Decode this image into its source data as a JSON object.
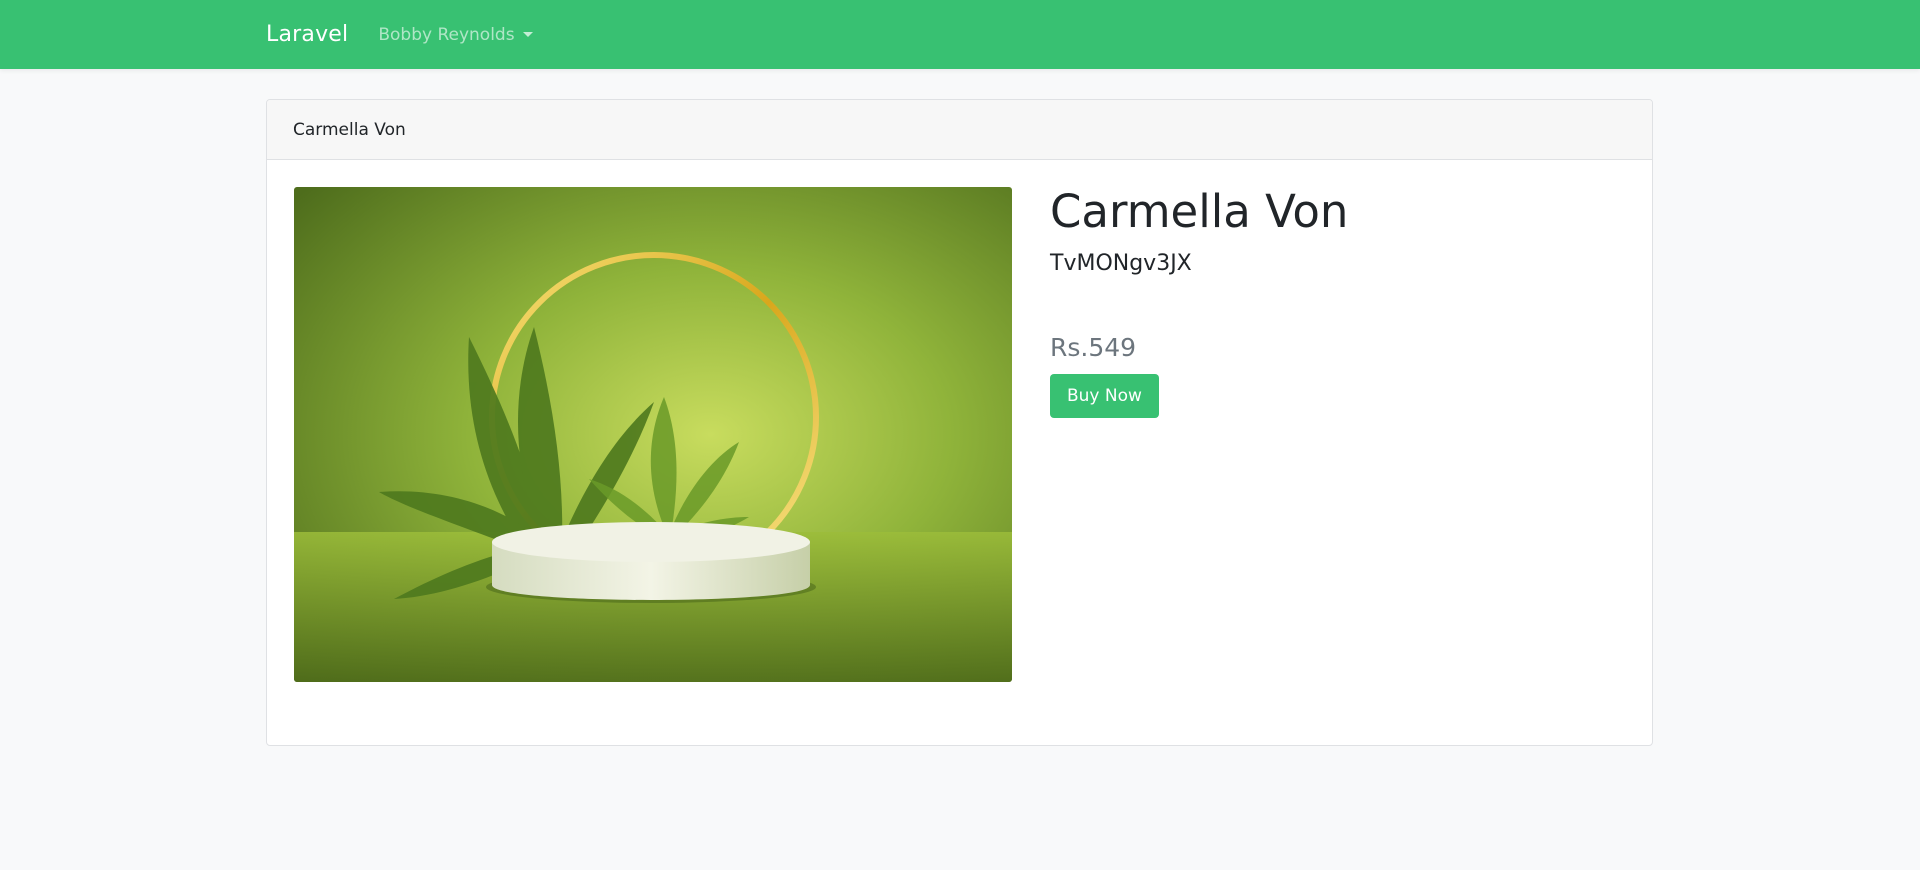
{
  "navbar": {
    "brand": "Laravel",
    "user_name": "Bobby Reynolds"
  },
  "card": {
    "header_title": "Carmella Von"
  },
  "product": {
    "name": "Carmella Von",
    "code": "TvMONgv3JX",
    "price": "Rs.549",
    "buy_label": "Buy Now"
  },
  "colors": {
    "brand_green": "#38c172",
    "price_gray": "#6c757d"
  }
}
